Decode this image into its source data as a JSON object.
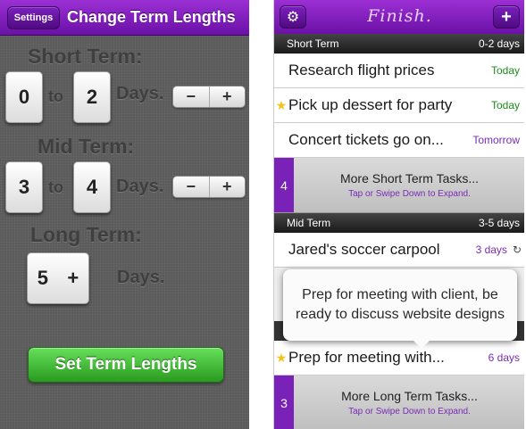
{
  "left": {
    "settings_label": "Settings",
    "title": "Change Term Lengths",
    "short": {
      "title": "Short Term:",
      "from": "0",
      "to_label": "to",
      "to": "2",
      "days": "Days."
    },
    "mid": {
      "title": "Mid Term:",
      "from": "3",
      "to_label": "to",
      "to": "4",
      "days": "Days."
    },
    "long": {
      "title": "Long Term:",
      "value": "5",
      "plus": "+",
      "days": "Days."
    },
    "stepper": {
      "minus": "−",
      "plus": "+"
    },
    "set_button": "Set Term Lengths"
  },
  "right": {
    "title": "Finish.",
    "gear_glyph": "⚙",
    "add_glyph": "+",
    "short_header": {
      "label": "Short Term",
      "range": "0-2 days"
    },
    "short_tasks": [
      {
        "star": "",
        "name": "Research flight prices",
        "due": "Today"
      },
      {
        "star": "★",
        "name": "Pick up dessert for party",
        "due": "Today"
      },
      {
        "star": "",
        "name": "Concert tickets go on...",
        "due": "Tomorrow"
      }
    ],
    "short_more": {
      "count": "4",
      "label": "More Short Term Tasks...",
      "hint": "Tap or Swipe Down to Expand."
    },
    "mid_header": {
      "label": "Mid Term",
      "range": "3-5 days"
    },
    "mid_tasks": [
      {
        "star": "",
        "name": "Jared's soccer carpool",
        "due": "3 days",
        "repeat": "↻"
      }
    ],
    "tooltip": "Prep for meeting with client, be ready to discuss website designs",
    "long_tasks": [
      {
        "star": "★",
        "name": "Prep for meeting with...",
        "due": "6 days"
      }
    ],
    "long_more": {
      "count": "3",
      "label": "More Long Term Tasks...",
      "hint": "Tap or Swipe Down to Expand."
    }
  },
  "colors": {
    "accent": "#7a22b8",
    "green": "#2a9a20",
    "star": "#f2c31a"
  }
}
